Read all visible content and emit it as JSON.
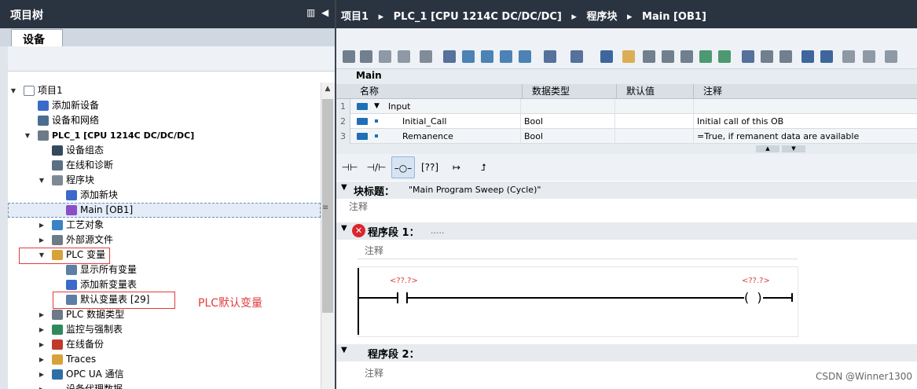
{
  "left_panel": {
    "title": "项目树",
    "tab": "设备"
  },
  "tree": {
    "project": "项目1",
    "add_device": "添加新设备",
    "devices_networks": "设备和网络",
    "plc": "PLC_1 [CPU 1214C DC/DC/DC]",
    "device_config": "设备组态",
    "online_diag": "在线和诊断",
    "program_blocks": "程序块",
    "add_block": "添加新块",
    "main_ob1": "Main [OB1]",
    "tech_objects": "工艺对象",
    "external_sources": "外部源文件",
    "plc_tags": "PLC 变量",
    "show_all_tags": "显示所有变量",
    "add_tag_table": "添加新变量表",
    "default_tag_table": "默认变量表 [29]",
    "plc_data_types": "PLC 数据类型",
    "watch_force": "监控与强制表",
    "online_backup": "在线备份",
    "traces": "Traces",
    "opc_ua": "OPC UA 通信",
    "device_proxy": "设备代理数据"
  },
  "annotation": "PLC默认变量",
  "breadcrumb": {
    "items": [
      "项目1",
      "PLC_1 [CPU 1214C DC/DC/DC]",
      "程序块",
      "Main [OB1]"
    ],
    "separator": "▸"
  },
  "interface": {
    "block_name": "Main",
    "columns": [
      "名称",
      "数据类型",
      "默认值",
      "注释"
    ],
    "rows": [
      {
        "num": "1",
        "name": "Input",
        "type": "",
        "default": "",
        "comment": ""
      },
      {
        "num": "2",
        "name": "Initial_Call",
        "type": "Bool",
        "default": "",
        "comment": "Initial call of this OB"
      },
      {
        "num": "3",
        "name": "Remanence",
        "type": "Bool",
        "default": "",
        "comment": "=True, if remanent data are available"
      }
    ]
  },
  "editor": {
    "block_title_label": "块标题：",
    "block_title_value": "\"Main Program Sweep (Cycle)\"",
    "comment": "注释",
    "network1_label": "程序段 1：",
    "network1_dots": ".....",
    "network2_label": "程序段 2：",
    "contact_operand": "<??.?>",
    "coil_operand": "<??.?>"
  },
  "colors": {
    "header_bg": "#2a3340",
    "selection": "#e3ecf7",
    "annotation_red": "#e23b3b",
    "error_red": "#d9262c"
  },
  "watermark": "CSDN @Winner1300"
}
